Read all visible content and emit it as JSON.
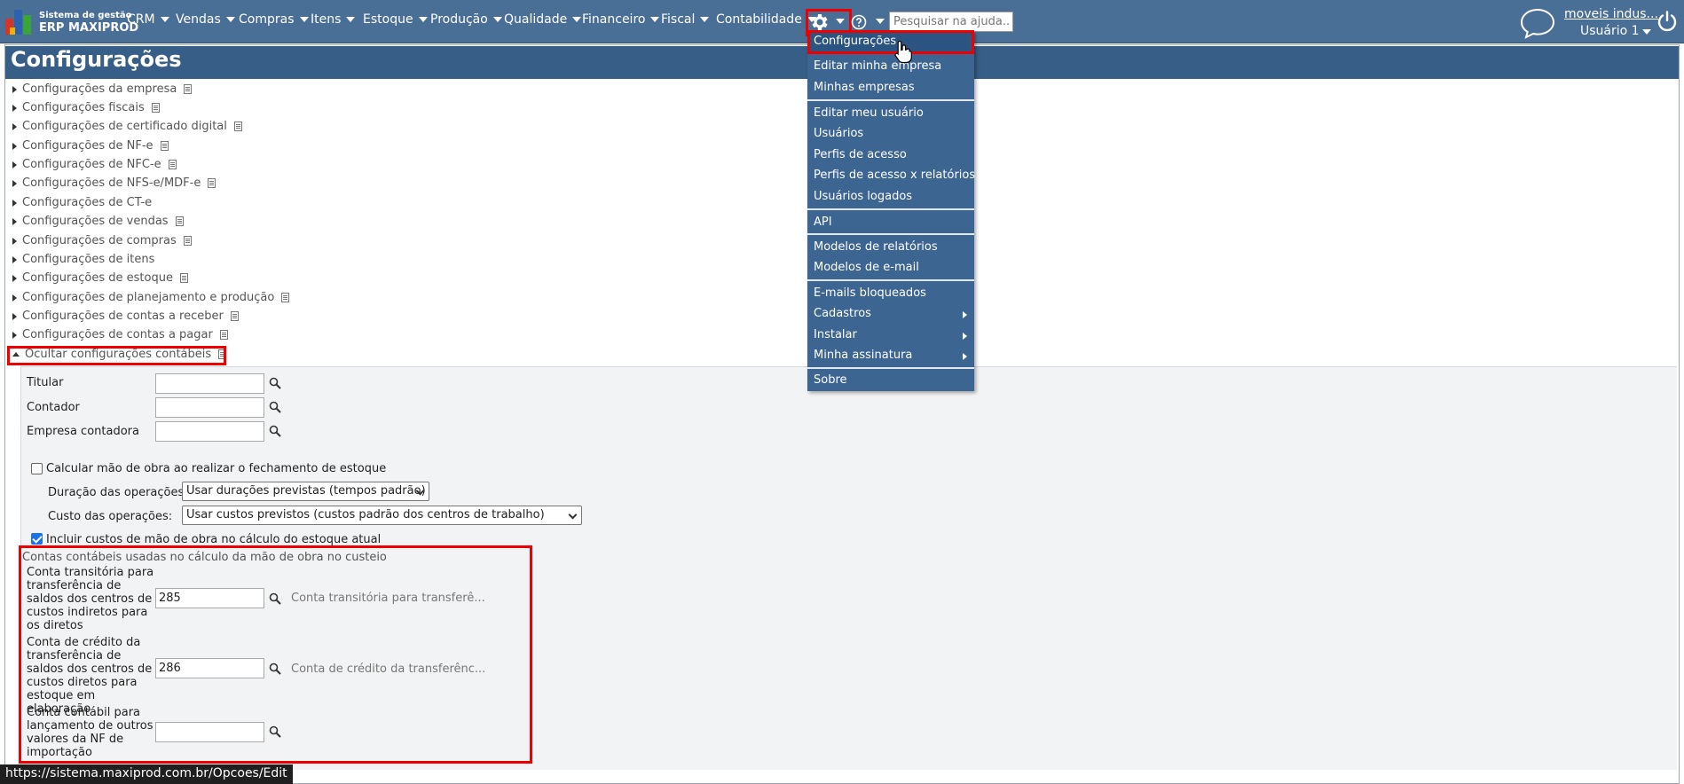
{
  "topbar": {
    "logo_line1": "Sistema de gestão",
    "logo_line2": "ERP MAXIPROD",
    "nav": [
      "CRM",
      "Vendas",
      "Compras",
      "Itens",
      "Estoque",
      "Produção",
      "Qualidade",
      "Financeiro",
      "Fiscal",
      "Contabilidade"
    ],
    "search_placeholder": "Pesquisar na ajuda...",
    "company": "moveis indus...",
    "user": "Usuário 1"
  },
  "page": {
    "title": "Configurações"
  },
  "config_sections": [
    "Configurações da empresa",
    "Configurações fiscais",
    "Configurações de certificado digital",
    "Configurações de NF-e",
    "Configurações de NFC-e",
    "Configurações de NFS-e/MDF-e",
    "Configurações de CT-e",
    "Configurações de vendas",
    "Configurações de compras",
    "Configurações de itens",
    "Configurações de estoque",
    "Configurações de planejamento e produção",
    "Configurações de contas a receber",
    "Configurações de contas a pagar"
  ],
  "hide_accounting_label": "Ocultar configurações contábeis",
  "accounting": {
    "titular_label": "Titular",
    "titular_value": "",
    "contador_label": "Contador",
    "contador_value": "",
    "empresa_contadora_label": "Empresa contadora",
    "empresa_contadora_value": "",
    "calc_labor_label": "Calcular mão de obra ao realizar o fechamento de estoque",
    "calc_labor_checked": false,
    "duration_label": "Duração das operações:",
    "duration_value": "Usar durações previstas (tempos padrão)",
    "cost_label": "Custo das operações:",
    "cost_value": "Usar custos previstos (custos padrão dos centros de trabalho)",
    "include_labor_label": "Incluir custos de mão de obra no cálculo do estoque atual",
    "include_labor_checked": true,
    "cost_accounts_title": "Contas contábeis usadas no cálculo da mão de obra no custeio",
    "transit_label": "Conta transitória para transferência de saldos dos centros de custos indiretos para os diretos",
    "transit_value": "285",
    "transit_hint": "Conta transitória para transferê...",
    "credit_label": "Conta de crédito da transferência de saldos dos centros de custos diretos para estoque em elaboração",
    "credit_value": "286",
    "credit_hint": "Conta de crédito da transferênc...",
    "import_label": "Conta contábil para lançamento de outros valores da NF de importação",
    "import_value": ""
  },
  "settings_menu": {
    "groups": [
      [
        "Configurações",
        "Editar minha empresa",
        "Minhas empresas"
      ],
      [
        "Editar meu usuário",
        "Usuários",
        "Perfis de acesso",
        "Perfis de acesso x relatórios",
        "Usuários logados"
      ],
      [
        "API"
      ],
      [
        "Modelos de relatórios",
        "Modelos de e-mail"
      ],
      [
        "E-mails bloqueados",
        "Cadastros",
        "Instalar",
        "Minha assinatura"
      ],
      [
        "Sobre"
      ]
    ]
  },
  "status_url": "https://sistema.maxiprod.com.br/Opcoes/Edit",
  "colors": {
    "topbar": "#4a6f96",
    "header": "#375e86",
    "menu": "#3c6591",
    "highlight": "#e00000"
  }
}
